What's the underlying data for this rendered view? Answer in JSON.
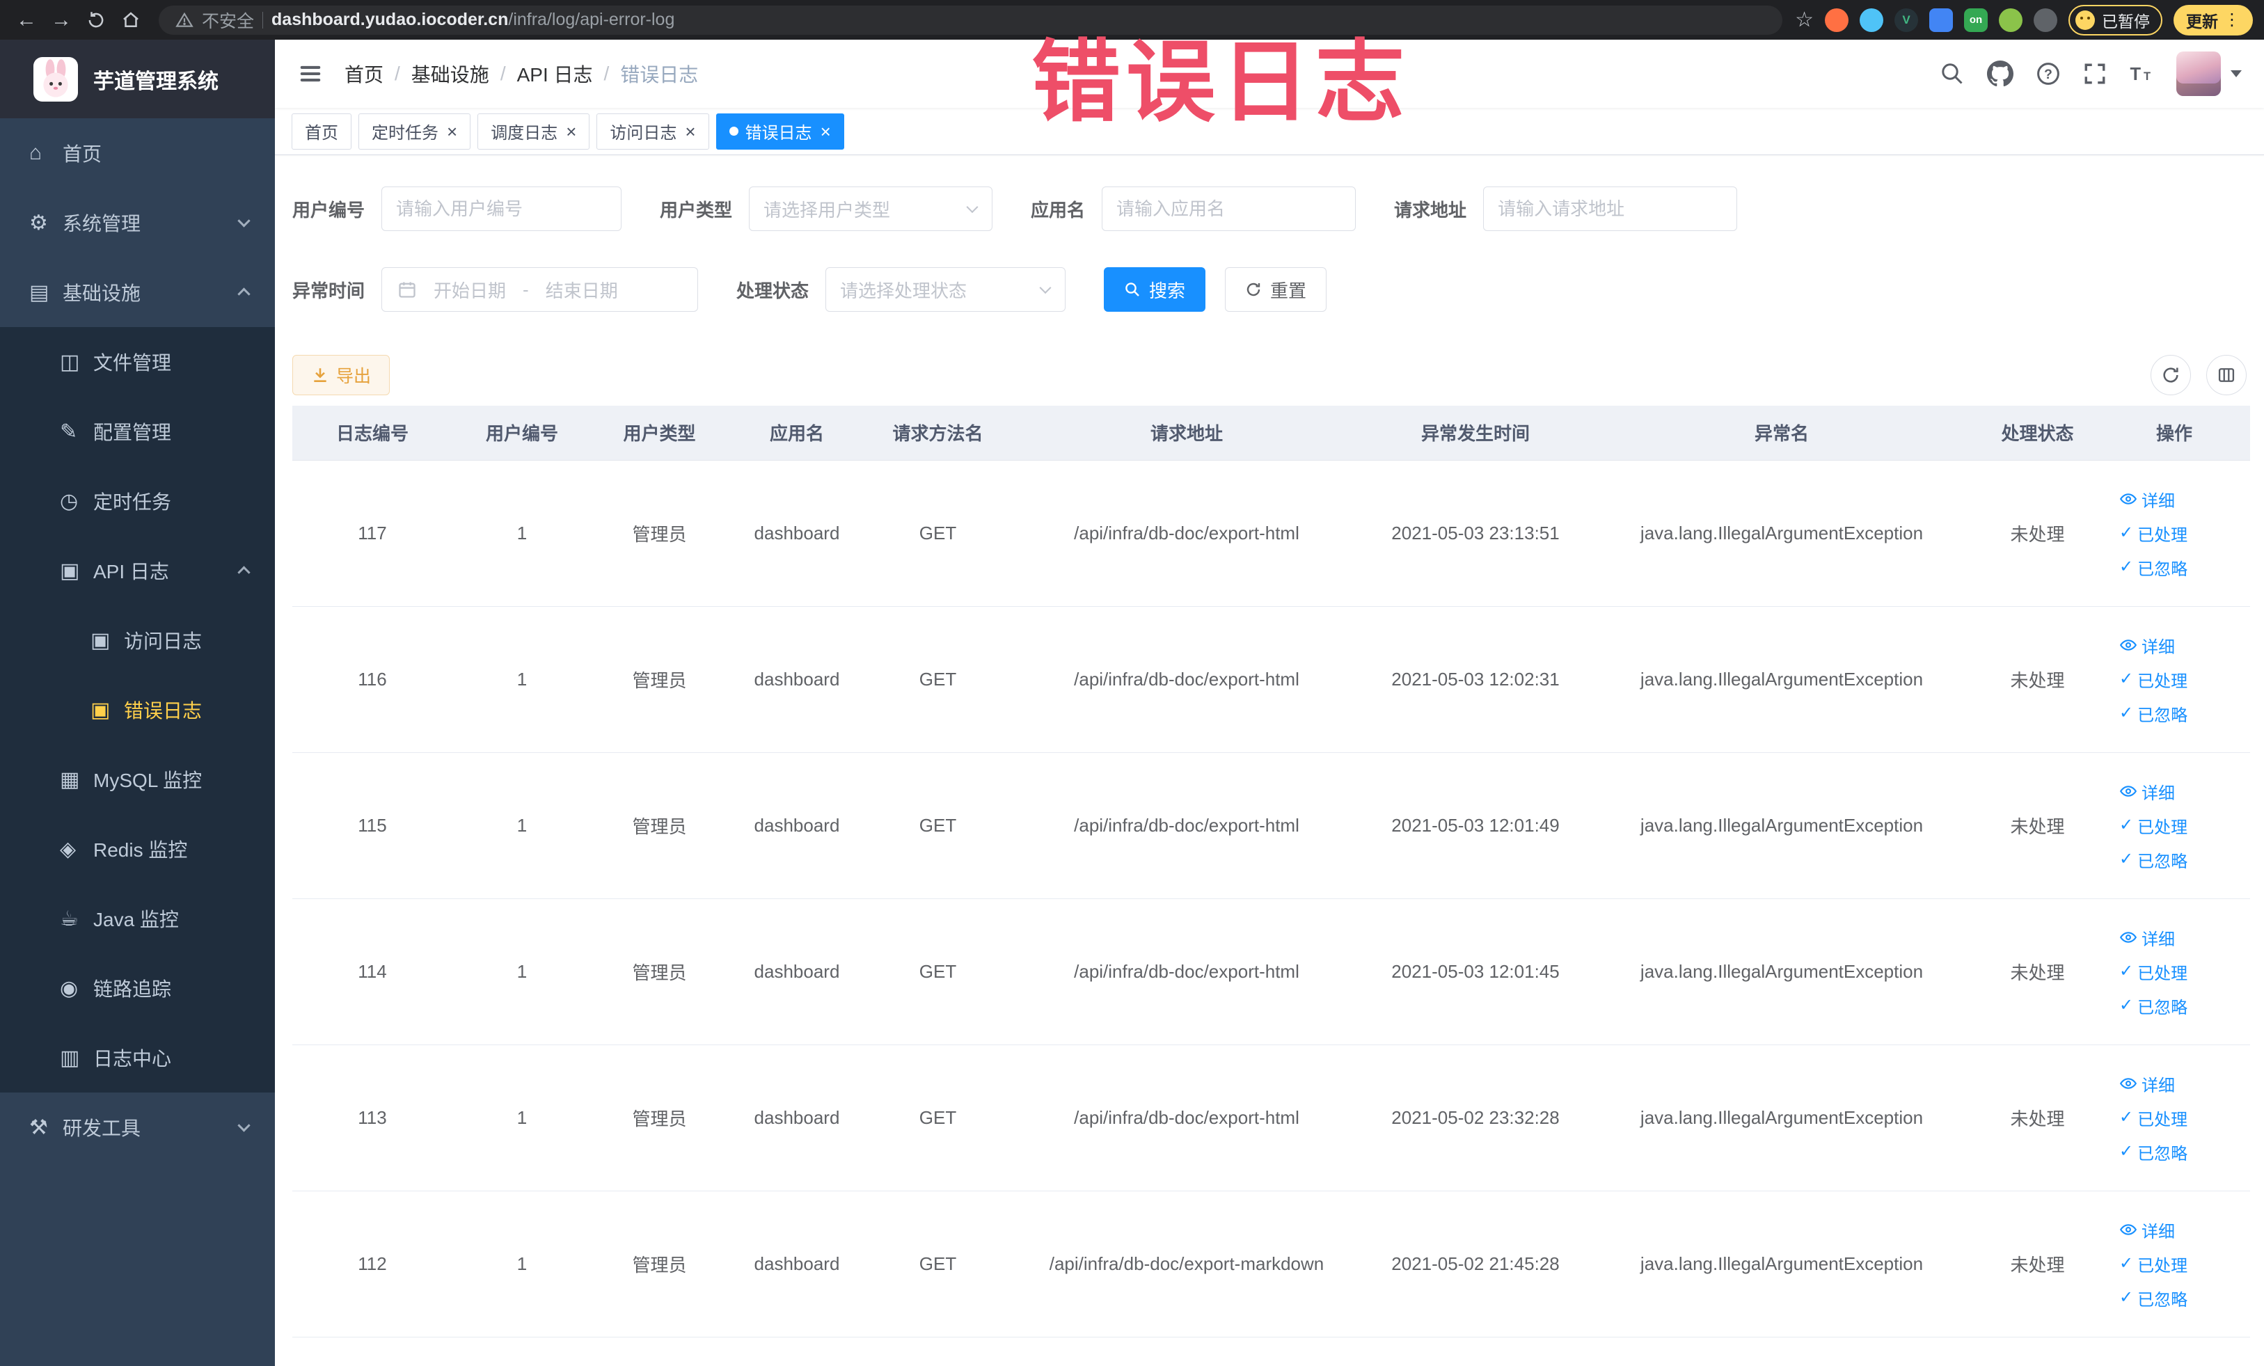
{
  "browser": {
    "security_label": "不安全",
    "url_host": "dashboard.yudao.iocoder.cn",
    "url_path": "/infra/log/api-error-log",
    "paused_badge": "已暂停",
    "update_label": "更新",
    "extension_badge_on": "on",
    "extension_vue_letter": "V"
  },
  "watermark_text": "错误日志",
  "sidebar": {
    "logo_title": "芋道管理系统",
    "menu": [
      {
        "key": "home",
        "label": "首页",
        "icon": "home-icon",
        "level": 1,
        "type": "item",
        "expanded": false,
        "active": false
      },
      {
        "key": "system-management",
        "label": "系统管理",
        "icon": "gear-icon",
        "level": 1,
        "type": "submenu",
        "expanded": false,
        "active": false
      },
      {
        "key": "infrastructure",
        "label": "基础设施",
        "icon": "infra-icon",
        "level": 1,
        "type": "submenu",
        "expanded": true,
        "active": false
      },
      {
        "key": "file-management",
        "label": "文件管理",
        "icon": "file-icon",
        "level": 2,
        "type": "item",
        "expanded": false,
        "active": false
      },
      {
        "key": "config-management",
        "label": "配置管理",
        "icon": "config-icon",
        "level": 2,
        "type": "item",
        "expanded": false,
        "active": false
      },
      {
        "key": "scheduled-tasks",
        "label": "定时任务",
        "icon": "timer-icon",
        "level": 2,
        "type": "item",
        "expanded": false,
        "active": false
      },
      {
        "key": "api-logs",
        "label": "API 日志",
        "icon": "api-log-icon",
        "level": 2,
        "type": "submenu",
        "expanded": true,
        "active": false
      },
      {
        "key": "access-log",
        "label": "访问日志",
        "icon": "access-log-icon",
        "level": 3,
        "type": "item",
        "expanded": false,
        "active": false
      },
      {
        "key": "error-log",
        "label": "错误日志",
        "icon": "error-log-icon",
        "level": 3,
        "type": "item",
        "expanded": false,
        "active": true
      },
      {
        "key": "mysql-monitor",
        "label": "MySQL 监控",
        "icon": "mysql-icon",
        "level": 2,
        "type": "item",
        "expanded": false,
        "active": false
      },
      {
        "key": "redis-monitor",
        "label": "Redis 监控",
        "icon": "redis-icon",
        "level": 2,
        "type": "item",
        "expanded": false,
        "active": false
      },
      {
        "key": "java-monitor",
        "label": "Java 监控",
        "icon": "java-icon",
        "level": 2,
        "type": "item",
        "expanded": false,
        "active": false
      },
      {
        "key": "link-tracing",
        "label": "链路追踪",
        "icon": "trace-icon",
        "level": 2,
        "type": "item",
        "expanded": false,
        "active": false
      },
      {
        "key": "log-center",
        "label": "日志中心",
        "icon": "log-center-icon",
        "level": 2,
        "type": "item",
        "expanded": false,
        "active": false
      },
      {
        "key": "dev-tools",
        "label": "研发工具",
        "icon": "tools-icon",
        "level": 1,
        "type": "submenu",
        "expanded": false,
        "active": false
      }
    ]
  },
  "header": {
    "breadcrumb": [
      "首页",
      "基础设施",
      "API 日志",
      "错误日志"
    ],
    "breadcrumb_separator": "/"
  },
  "tabs": [
    {
      "key": "home",
      "label": "首页",
      "closable": false,
      "active": false
    },
    {
      "key": "scheduled-tasks",
      "label": "定时任务",
      "closable": true,
      "active": false
    },
    {
      "key": "schedule-log",
      "label": "调度日志",
      "closable": true,
      "active": false
    },
    {
      "key": "access-log",
      "label": "访问日志",
      "closable": true,
      "active": false
    },
    {
      "key": "error-log",
      "label": "错误日志",
      "closable": true,
      "active": true
    }
  ],
  "filters": {
    "user_id": {
      "label": "用户编号",
      "placeholder": "请输入用户编号"
    },
    "user_type": {
      "label": "用户类型",
      "placeholder": "请选择用户类型"
    },
    "app_name": {
      "label": "应用名",
      "placeholder": "请输入应用名"
    },
    "request_url": {
      "label": "请求地址",
      "placeholder": "请输入请求地址"
    },
    "exception_time": {
      "label": "异常时间",
      "start_placeholder": "开始日期",
      "separator": "-",
      "end_placeholder": "结束日期"
    },
    "process_status": {
      "label": "处理状态",
      "placeholder": "请选择处理状态"
    },
    "search_label": "搜索",
    "reset_label": "重置"
  },
  "toolbar": {
    "export_label": "导出"
  },
  "table": {
    "columns": [
      "日志编号",
      "用户编号",
      "用户类型",
      "应用名",
      "请求方法名",
      "请求地址",
      "异常发生时间",
      "异常名",
      "处理状态",
      "操作"
    ],
    "action_labels": {
      "detail": "详细",
      "processed": "已处理",
      "ignored": "已忽略"
    },
    "rows": [
      {
        "log_id": "117",
        "user_id": "1",
        "user_type": "管理员",
        "app_name": "dashboard",
        "method": "GET",
        "url": "/api/infra/db-doc/export-html",
        "time": "2021-05-03 23:13:51",
        "exception": "java.lang.IllegalArgumentException",
        "status": "未处理"
      },
      {
        "log_id": "116",
        "user_id": "1",
        "user_type": "管理员",
        "app_name": "dashboard",
        "method": "GET",
        "url": "/api/infra/db-doc/export-html",
        "time": "2021-05-03 12:02:31",
        "exception": "java.lang.IllegalArgumentException",
        "status": "未处理"
      },
      {
        "log_id": "115",
        "user_id": "1",
        "user_type": "管理员",
        "app_name": "dashboard",
        "method": "GET",
        "url": "/api/infra/db-doc/export-html",
        "time": "2021-05-03 12:01:49",
        "exception": "java.lang.IllegalArgumentException",
        "status": "未处理"
      },
      {
        "log_id": "114",
        "user_id": "1",
        "user_type": "管理员",
        "app_name": "dashboard",
        "method": "GET",
        "url": "/api/infra/db-doc/export-html",
        "time": "2021-05-03 12:01:45",
        "exception": "java.lang.IllegalArgumentException",
        "status": "未处理"
      },
      {
        "log_id": "113",
        "user_id": "1",
        "user_type": "管理员",
        "app_name": "dashboard",
        "method": "GET",
        "url": "/api/infra/db-doc/export-html",
        "time": "2021-05-02 23:32:28",
        "exception": "java.lang.IllegalArgumentException",
        "status": "未处理"
      },
      {
        "log_id": "112",
        "user_id": "1",
        "user_type": "管理员",
        "app_name": "dashboard",
        "method": "GET",
        "url": "/api/infra/db-doc/export-markdown",
        "time": "2021-05-02 21:45:28",
        "exception": "java.lang.IllegalArgumentException",
        "status": "未处理"
      }
    ]
  },
  "colors": {
    "primary": "#1890ff",
    "sidebar_bg": "#304156",
    "sidebar_submenu_bg": "#1f2d3d",
    "sidebar_active_text": "#ffd04b",
    "watermark": "#ee4e68",
    "warning": "#e6a23c"
  }
}
